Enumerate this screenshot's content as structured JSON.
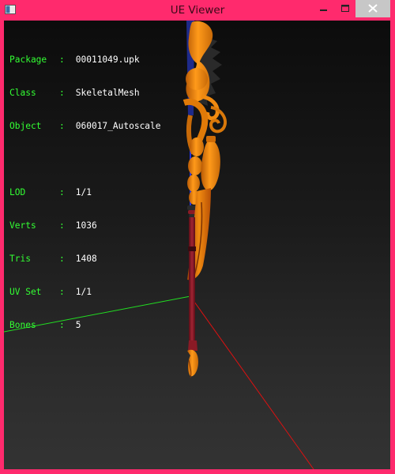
{
  "window": {
    "title": "UE Viewer",
    "frame_color": "#ff2a6d",
    "icons": {
      "app": "app-window-icon",
      "minimize": "minimize-icon",
      "maximize": "maximize-icon",
      "close": "close-icon"
    }
  },
  "info": {
    "package": {
      "label": "Package",
      "sep": ":",
      "value": "00011049.upk"
    },
    "class": {
      "label": "Class",
      "sep": ":",
      "value": "SkeletalMesh"
    },
    "object": {
      "label": "Object",
      "sep": ":",
      "value": "060017_Autoscale"
    },
    "lod": {
      "label": "LOD",
      "sep": ":",
      "value": "1/1"
    },
    "verts": {
      "label": "Verts",
      "sep": ":",
      "value": "1036"
    },
    "tris": {
      "label": "Tris",
      "sep": ":",
      "value": "1408"
    },
    "uvset": {
      "label": "UV Set",
      "sep": ":",
      "value": "1/1"
    },
    "bones": {
      "label": "Bones",
      "sep": ":",
      "value": "5"
    }
  },
  "colors": {
    "label_text": "#33ff33",
    "value_text": "#ffffff",
    "axis_x": "#dd1111",
    "axis_z": "#22dd22",
    "axis_y": "#2233dd",
    "mesh_orange": "#f08a10",
    "mesh_shaft": "#8a1a25"
  }
}
